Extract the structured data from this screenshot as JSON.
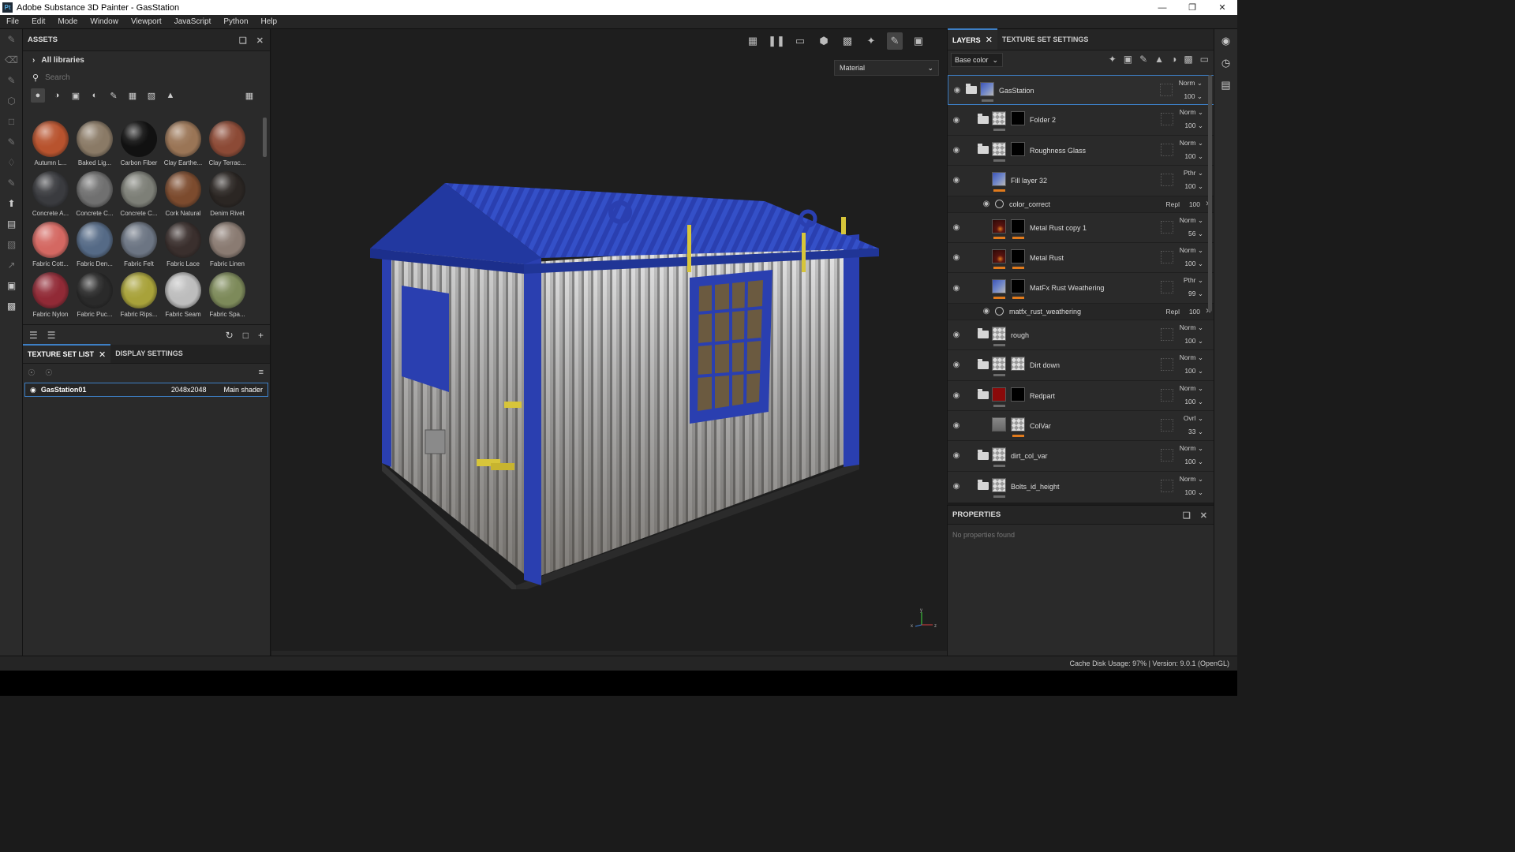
{
  "window": {
    "title": "Adobe Substance 3D Painter - GasStation",
    "badge": "Pt"
  },
  "menu": [
    "File",
    "Edit",
    "Mode",
    "Window",
    "Viewport",
    "JavaScript",
    "Python",
    "Help"
  ],
  "assets": {
    "title": "ASSETS",
    "library": "All libraries",
    "search_placeholder": "Search",
    "materials": [
      {
        "label": "Autumn L...",
        "color": "#b8532e"
      },
      {
        "label": "Baked Lig...",
        "color": "#8a7a66"
      },
      {
        "label": "Carbon Fiber",
        "color": "#111111"
      },
      {
        "label": "Clay Earthe...",
        "color": "#9a7556"
      },
      {
        "label": "Clay Terrac...",
        "color": "#8c4a36"
      },
      {
        "label": "Concrete A...",
        "color": "#3a3b3f"
      },
      {
        "label": "Concrete C...",
        "color": "#707070"
      },
      {
        "label": "Concrete C...",
        "color": "#7d7f77"
      },
      {
        "label": "Cork Natural",
        "color": "#7c4b2e"
      },
      {
        "label": "Denim Rivet",
        "color": "#2b2623"
      },
      {
        "label": "Fabric Cott...",
        "color": "#d46862"
      },
      {
        "label": "Fabric Den...",
        "color": "#556a86"
      },
      {
        "label": "Fabric Felt",
        "color": "#6c7583"
      },
      {
        "label": "Fabric Lace",
        "color": "#3a2f2d"
      },
      {
        "label": "Fabric Linen",
        "color": "#8a7b72"
      },
      {
        "label": "Fabric Nylon",
        "color": "#912a36"
      },
      {
        "label": "Fabric Puc...",
        "color": "#2a2a2a"
      },
      {
        "label": "Fabric Rips...",
        "color": "#a8a23a"
      },
      {
        "label": "Fabric Seam",
        "color": "#bdbdbd"
      },
      {
        "label": "Fabric Spa...",
        "color": "#7d8a5a"
      }
    ]
  },
  "texture_set": {
    "tabs": [
      "TEXTURE SET LIST",
      "DISPLAY SETTINGS"
    ],
    "item": {
      "name": "GasStation01",
      "resolution": "2048x2048",
      "shader": "Main shader"
    }
  },
  "viewport": {
    "material_mode": "Material"
  },
  "layers_panel": {
    "tabs": [
      "LAYERS",
      "TEXTURE SET SETTINGS"
    ],
    "channel": "Base color",
    "layers": [
      {
        "name": "GasStation",
        "blend": "Norm",
        "opacity": "100",
        "selected": true,
        "folder": true,
        "thumb": "house",
        "mask": "none",
        "tags": "grey"
      },
      {
        "name": "Folder 2",
        "blend": "Norm",
        "opacity": "100",
        "folder": true,
        "thumb": "checker",
        "mask": "black",
        "tags": "grey"
      },
      {
        "name": "Roughness Glass",
        "blend": "Norm",
        "opacity": "100",
        "folder": true,
        "thumb": "checker",
        "mask": "black",
        "tags": "grey"
      },
      {
        "name": "Fill layer 32",
        "blend": "Pthr",
        "opacity": "100",
        "thumb": "house",
        "mask": "none",
        "tags": "orange"
      },
      {
        "name": "color_correct",
        "sub": true,
        "blend": "Repl",
        "opacity": "100"
      },
      {
        "name": "Metal Rust copy 1",
        "blend": "Norm",
        "opacity": "56",
        "thumb": "rust",
        "mask": "black",
        "tags": "orange2"
      },
      {
        "name": "Metal Rust",
        "blend": "Norm",
        "opacity": "100",
        "thumb": "rust",
        "mask": "black",
        "tags": "orange2"
      },
      {
        "name": "MatFx Rust Weathering",
        "blend": "Pthr",
        "opacity": "99",
        "thumb": "house",
        "mask": "black",
        "tags": "orange2"
      },
      {
        "name": "matfx_rust_weathering",
        "sub": true,
        "blend": "Repl",
        "opacity": "100"
      },
      {
        "name": "rough",
        "blend": "Norm",
        "opacity": "100",
        "folder": true,
        "thumb": "checker",
        "mask": "none",
        "tags": "grey"
      },
      {
        "name": "Dirt down",
        "blend": "Norm",
        "opacity": "100",
        "folder": true,
        "thumb": "checker",
        "mask": "light",
        "tags": "grey"
      },
      {
        "name": "Redpart",
        "blend": "Norm",
        "opacity": "100",
        "folder": true,
        "thumb": "red",
        "mask": "black",
        "tags": "grey"
      },
      {
        "name": "ColVar",
        "blend": "Ovrl",
        "opacity": "33",
        "thumb": "grey",
        "mask": "checker",
        "tags": "orange-right"
      },
      {
        "name": "dirt_col_var",
        "blend": "Norm",
        "opacity": "100",
        "folder": true,
        "thumb": "checker",
        "mask": "none",
        "tags": "grey"
      },
      {
        "name": "Bolts_id_height",
        "blend": "Norm",
        "opacity": "100",
        "folder": true,
        "thumb": "checker",
        "mask": "none",
        "tags": "grey"
      }
    ]
  },
  "properties": {
    "title": "PROPERTIES",
    "empty": "No properties found"
  },
  "status": {
    "text": "Cache Disk Usage:   97% | Version: 9.0.1 (OpenGL)"
  },
  "axis": {
    "y": "y",
    "x": "x",
    "z": "z"
  }
}
